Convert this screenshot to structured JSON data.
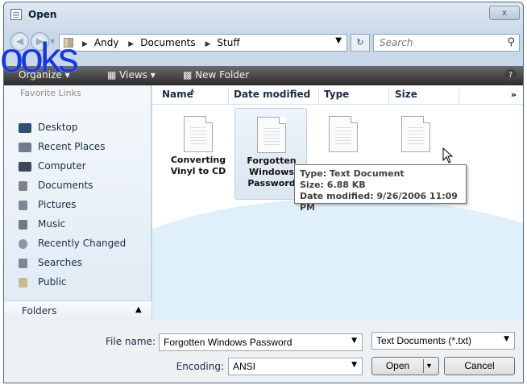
{
  "window": {
    "title": "Open",
    "close_glyph": "x"
  },
  "nav": {
    "back_icon": "back-arrow-icon",
    "forward_icon": "forward-arrow-icon"
  },
  "address": {
    "crumbs": [
      "Andy",
      "Documents",
      "Stuff"
    ],
    "refresh_glyph": "↻"
  },
  "search": {
    "placeholder": "Search"
  },
  "toolbar": {
    "organize_label": "Organize",
    "views_label": "Views",
    "new_folder_label": "New Folder",
    "help_glyph": "?"
  },
  "left_pane": {
    "header": "Favorite Links",
    "items": [
      {
        "label": "Desktop",
        "icon": "desktop-icon",
        "color": "#2f4f73"
      },
      {
        "label": "Recent Places",
        "icon": "recent-places-icon",
        "color": "#6f7b88"
      },
      {
        "label": "Computer",
        "icon": "computer-icon",
        "color": "#3b4957"
      },
      {
        "label": "Documents",
        "icon": "documents-icon",
        "color": "#7a838d"
      },
      {
        "label": "Pictures",
        "icon": "pictures-icon",
        "color": "#7b8794"
      },
      {
        "label": "Music",
        "icon": "music-icon",
        "color": "#6d7a88"
      },
      {
        "label": "Recently Changed",
        "icon": "recently-changed-icon",
        "color": "#8a96a3"
      },
      {
        "label": "Searches",
        "icon": "searches-icon",
        "color": "#7c8794"
      },
      {
        "label": "Public",
        "icon": "public-icon",
        "color": "#c9b98e"
      }
    ],
    "folders_label": "Folders"
  },
  "columns": {
    "name": "Name",
    "date": "Date modified",
    "type": "Type",
    "size": "Size",
    "more": "»"
  },
  "files": [
    {
      "name_line1": "Converting",
      "name_line2": "Vinyl to CD",
      "name_line3": ""
    },
    {
      "name_line1": "Forgotten",
      "name_line2": "Windows",
      "name_line3": "Password"
    },
    {
      "name_line1": "",
      "name_line2": "",
      "name_line3": ""
    },
    {
      "name_line1": "",
      "name_line2": "",
      "name_line3": ""
    }
  ],
  "tooltip": {
    "type": "Type: Text Document",
    "size": "Size: 6.88 KB",
    "date": "Date modified: 9/26/2006 11:09 PM"
  },
  "bottom": {
    "filename_label": "File name:",
    "filename_value": "Forgotten Windows Password",
    "filetype_value": "Text Documents (*.txt)",
    "encoding_label": "Encoding:",
    "encoding_value": "ANSI",
    "open_label": "Open",
    "cancel_label": "Cancel"
  },
  "watermark": {
    "text": "ooks"
  }
}
